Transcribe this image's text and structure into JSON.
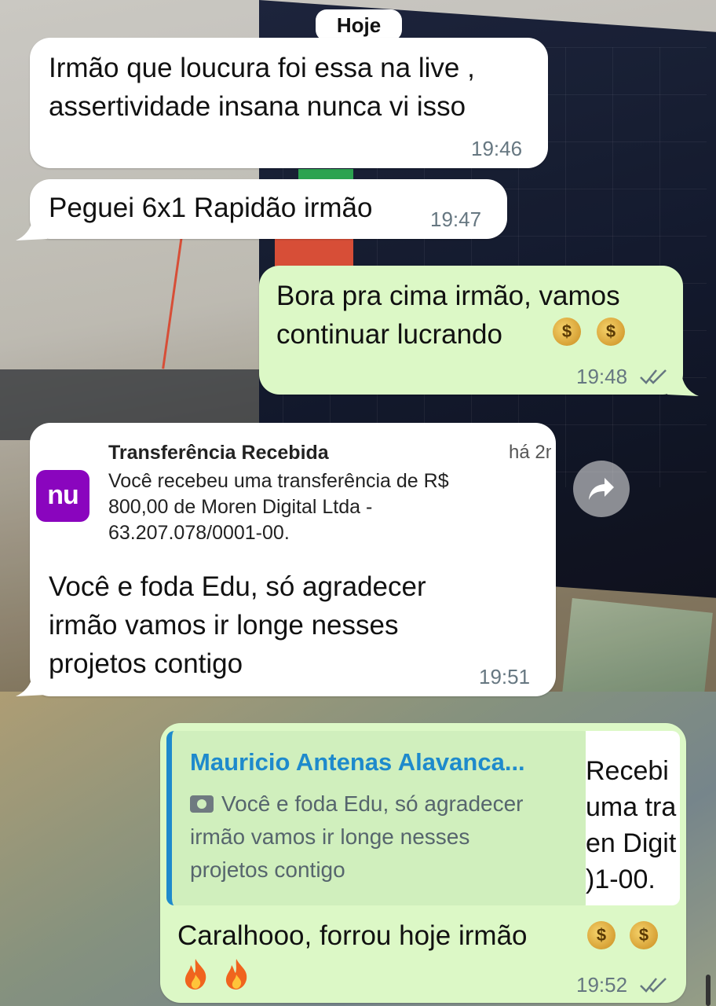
{
  "date_label": "Hoje",
  "messages": [
    {
      "direction": "incoming",
      "text": "Irmão que loucura foi essa na live ,\nassertividade insana nunca vi isso",
      "time": "19:46"
    },
    {
      "direction": "incoming",
      "text": "Peguei 6x1 Rapidão irmão",
      "time": "19:47"
    },
    {
      "direction": "outgoing",
      "text": "Bora pra cima irmão, vamos\ncontinuar lucrando",
      "emojis": "💰 💰",
      "time": "19:48",
      "status": "read"
    },
    {
      "direction": "incoming",
      "text": "Você e foda Edu, só agradecer\nirmão vamos ir longe nesses\nprojetos contigo",
      "time": "19:51",
      "notification": {
        "app": "nu",
        "title": "Transferência Recebida",
        "time": "há 2m",
        "body": "Você recebeu uma transferência de R$\n800,00 de Moren Digital Ltda -\n63.207.078/0001-00."
      }
    },
    {
      "direction": "outgoing",
      "text": "Caralhooo, forrou hoje irmão",
      "emojis": "💰 💰 🔥 🔥",
      "time": "19:52",
      "status": "read",
      "reply_to": {
        "author": "Mauricio Antenas Alavanca...",
        "text": "Você e foda Edu, só agradecer\nirmão vamos ir longe nesses\nprojetos contigo",
        "thumbnail_text": "Recebi\numa tra\nen Digit\n)1-00."
      }
    }
  ],
  "icons": {
    "forward": "forward-arrow-icon",
    "read": "double-check-icon",
    "camera": "camera-icon",
    "money": "money-bag-emoji",
    "fire": "fire-emoji"
  },
  "colors": {
    "incoming_bubble": "#ffffff",
    "outgoing_bubble": "#dcf8c6",
    "quote_author": "#1e8acc",
    "nubank": "#8a05be"
  }
}
